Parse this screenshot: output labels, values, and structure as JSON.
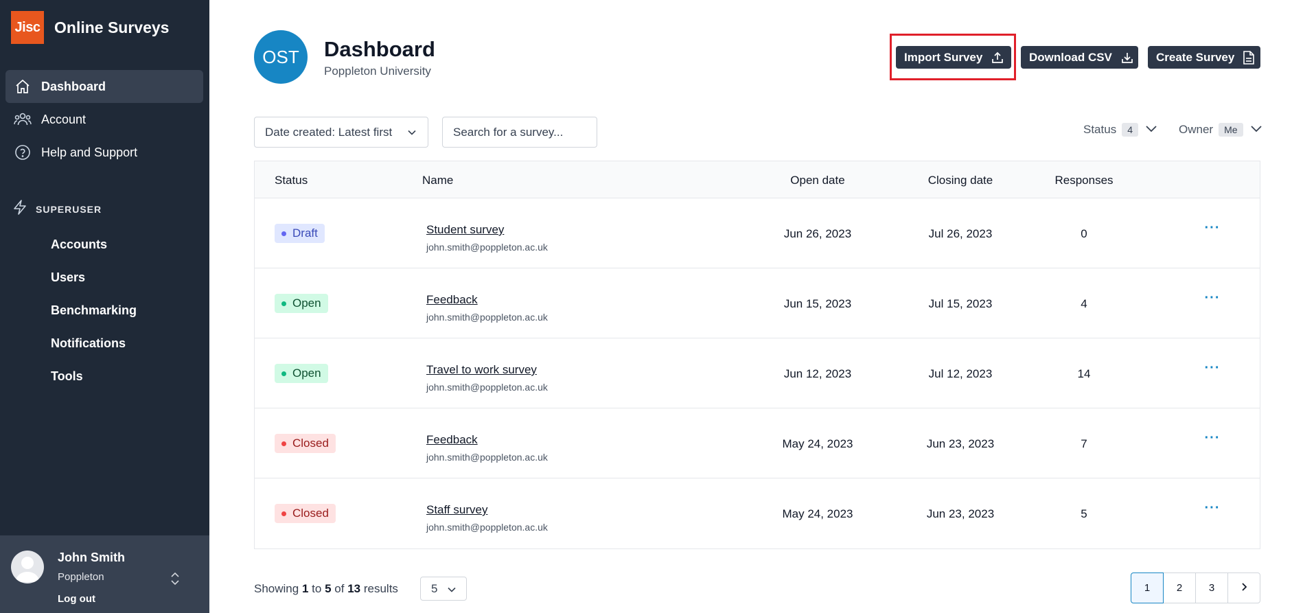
{
  "brand": {
    "logo_text": "Jisc",
    "app_name": "Online Surveys",
    "logo_color": "#e8571e"
  },
  "sidebar": {
    "items": [
      {
        "label": "Dashboard",
        "icon": "home-icon",
        "active": true
      },
      {
        "label": "Account",
        "icon": "users-icon",
        "active": false
      },
      {
        "label": "Help and Support",
        "icon": "help-circle-icon",
        "active": false
      }
    ],
    "superuser": {
      "label": "SUPERUSER",
      "icon": "lightning-icon",
      "items": [
        "Accounts",
        "Users",
        "Benchmarking",
        "Notifications",
        "Tools"
      ]
    }
  },
  "user": {
    "name": "John Smith",
    "org": "Poppleton",
    "logout": "Log out"
  },
  "header": {
    "initials": "OST",
    "title": "Dashboard",
    "subtitle": "Poppleton University",
    "import_label": "Import Survey",
    "download_label": "Download CSV",
    "create_label": "Create Survey"
  },
  "filters": {
    "sort": "Date created: Latest first",
    "search_placeholder": "Search for a survey...",
    "status_label": "Status",
    "status_count": "4",
    "owner_label": "Owner",
    "owner_value": "Me"
  },
  "table": {
    "headers": {
      "status": "Status",
      "name": "Name",
      "open": "Open date",
      "close": "Closing date",
      "responses": "Responses"
    },
    "rows": [
      {
        "status": "Draft",
        "kind": "draft",
        "name": "Student survey",
        "owner": "john.smith@poppleton.ac.uk",
        "open": "Jun 26, 2023",
        "close": "Jul 26, 2023",
        "responses": "0"
      },
      {
        "status": "Open",
        "kind": "open",
        "name": "Feedback",
        "owner": "john.smith@poppleton.ac.uk",
        "open": "Jun 15, 2023",
        "close": "Jul 15, 2023",
        "responses": "4"
      },
      {
        "status": "Open",
        "kind": "open",
        "name": "Travel to work survey",
        "owner": "john.smith@poppleton.ac.uk",
        "open": "Jun 12, 2023",
        "close": "Jul 12, 2023",
        "responses": "14"
      },
      {
        "status": "Closed",
        "kind": "closed",
        "name": "Feedback",
        "owner": "john.smith@poppleton.ac.uk",
        "open": "May 24, 2023",
        "close": "Jun 23, 2023",
        "responses": "7"
      },
      {
        "status": "Closed",
        "kind": "closed",
        "name": "Staff survey",
        "owner": "john.smith@poppleton.ac.uk",
        "open": "May 24, 2023",
        "close": "Jun 23, 2023",
        "responses": "5"
      }
    ]
  },
  "footer": {
    "showing_prefix": "Showing",
    "from": "1",
    "to_word": "to",
    "to": "5",
    "of_word": "of",
    "total": "13",
    "results_word": "results",
    "per_page": "5",
    "pages": [
      "1",
      "2",
      "3"
    ],
    "current_page": "1"
  },
  "colors": {
    "sidebar": "#1f2937",
    "accent": "#1786c4",
    "button": "#2d3748",
    "highlight": "#e0202a"
  }
}
